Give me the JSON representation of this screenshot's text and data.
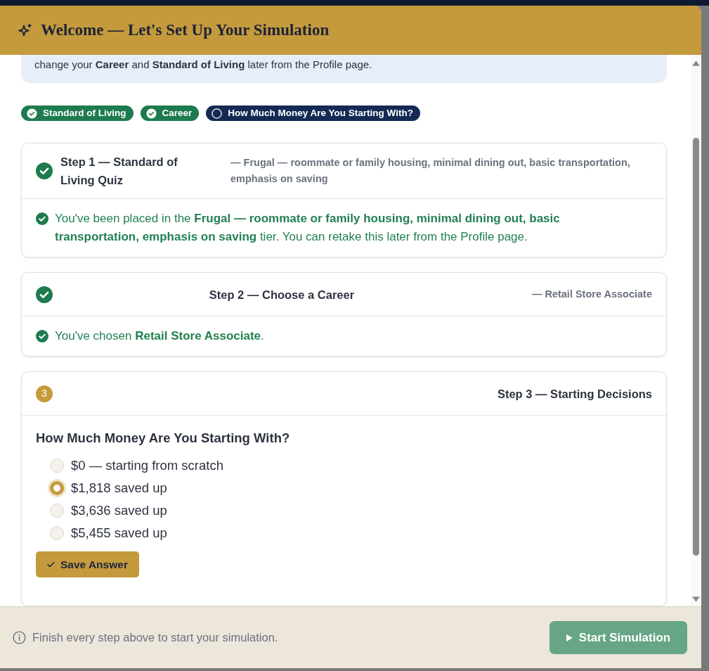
{
  "dialog": {
    "title": "Welcome — Let's Set Up Your Simulation"
  },
  "notice": {
    "text": "change your **Career** and **Standard of Living** later from the Profile page."
  },
  "progress": [
    {
      "label": "Standard of Living",
      "completed": true
    },
    {
      "label": "Career",
      "completed": true
    },
    {
      "label": "How Much Money Are You Starting With?",
      "completed": false
    }
  ],
  "steps": [
    {
      "title": "Step 1 — Standard of Living Quiz",
      "completed": true,
      "summary": "— Frugal — roommate or family housing, minimal dining out, basic transportation, emphasis on saving",
      "body": {
        "kind": "result",
        "message": "You've been placed in the **Frugal — roommate or family housing, minimal dining out, basic transportation, emphasis on saving** tier. You can retake this later from the Profile page."
      }
    },
    {
      "title": "Step 2 — Choose a Career",
      "completed": true,
      "summary": "— Retail Store Associate",
      "body": {
        "kind": "result",
        "message": "You've chosen **Retail Store Associate**."
      }
    },
    {
      "title": "Step 3 — Starting Decisions",
      "completed": false,
      "badge": "3",
      "body": {
        "kind": "question",
        "question": "How Much Money Are You Starting With?",
        "options": [
          {
            "label": "$0 — starting from scratch",
            "selected": false
          },
          {
            "label": "$1,818 saved up",
            "selected": true
          },
          {
            "label": "$3,636 saved up",
            "selected": false
          },
          {
            "label": "$5,455 saved up",
            "selected": false
          }
        ],
        "button": "Save Answer"
      }
    }
  ],
  "footer": {
    "hint": "Finish every step above to start your simulation.",
    "button": {
      "label": "Start Simulation",
      "disabled": true
    }
  }
}
